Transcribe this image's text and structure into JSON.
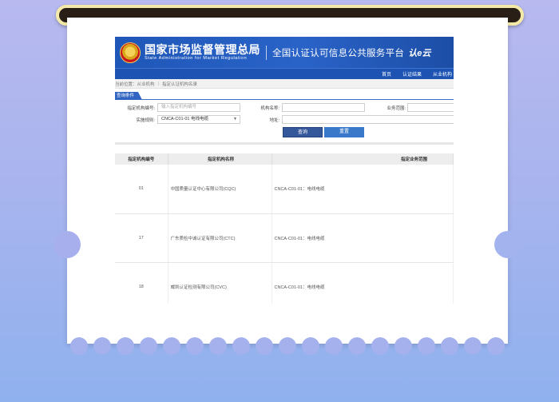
{
  "site": {
    "brand_cn": "国家市场监督管理总局",
    "brand_en": "State Administration for Market Regulation",
    "platform_title": "全国认证认可信息公共服务平台",
    "logo_mark": "认e云",
    "nav": [
      "首页",
      "认证结果",
      "从业机构"
    ],
    "breadcrumb": [
      "当前位置：从业机构",
      "指定认证机构名录"
    ],
    "filter_tab": "查询条件",
    "form": {
      "code_label": "指定机构编号:",
      "code_placeholder": "输入指定机构编号",
      "name_label": "机构名称:",
      "scope_label": "业务范围:",
      "rule_label": "实施规则:",
      "rule_value": "CNCA-C01-01 电线电缆",
      "address_label": "地址:",
      "query_button": "查询",
      "reset_button": "重置"
    },
    "table": {
      "headers": [
        "指定机构编号",
        "指定机构名称",
        "指定业务范围"
      ],
      "rows": [
        [
          "01",
          "中国质量认证中心有限公司(CQC)",
          "CNCA-C01-01：电线电缆"
        ],
        [
          "17",
          "广东质检中诚认证有限公司(CTC)",
          "CNCA-C01-01：电线电缆"
        ],
        [
          "18",
          "威凯认证检测有限公司(CVC)",
          "CNCA-C01-01：电线电缆"
        ]
      ]
    }
  },
  "colors": {
    "banner_blue": "#1f57b8",
    "roller_dark": "#2a1f17",
    "roller_rim": "#f4e9a8"
  }
}
